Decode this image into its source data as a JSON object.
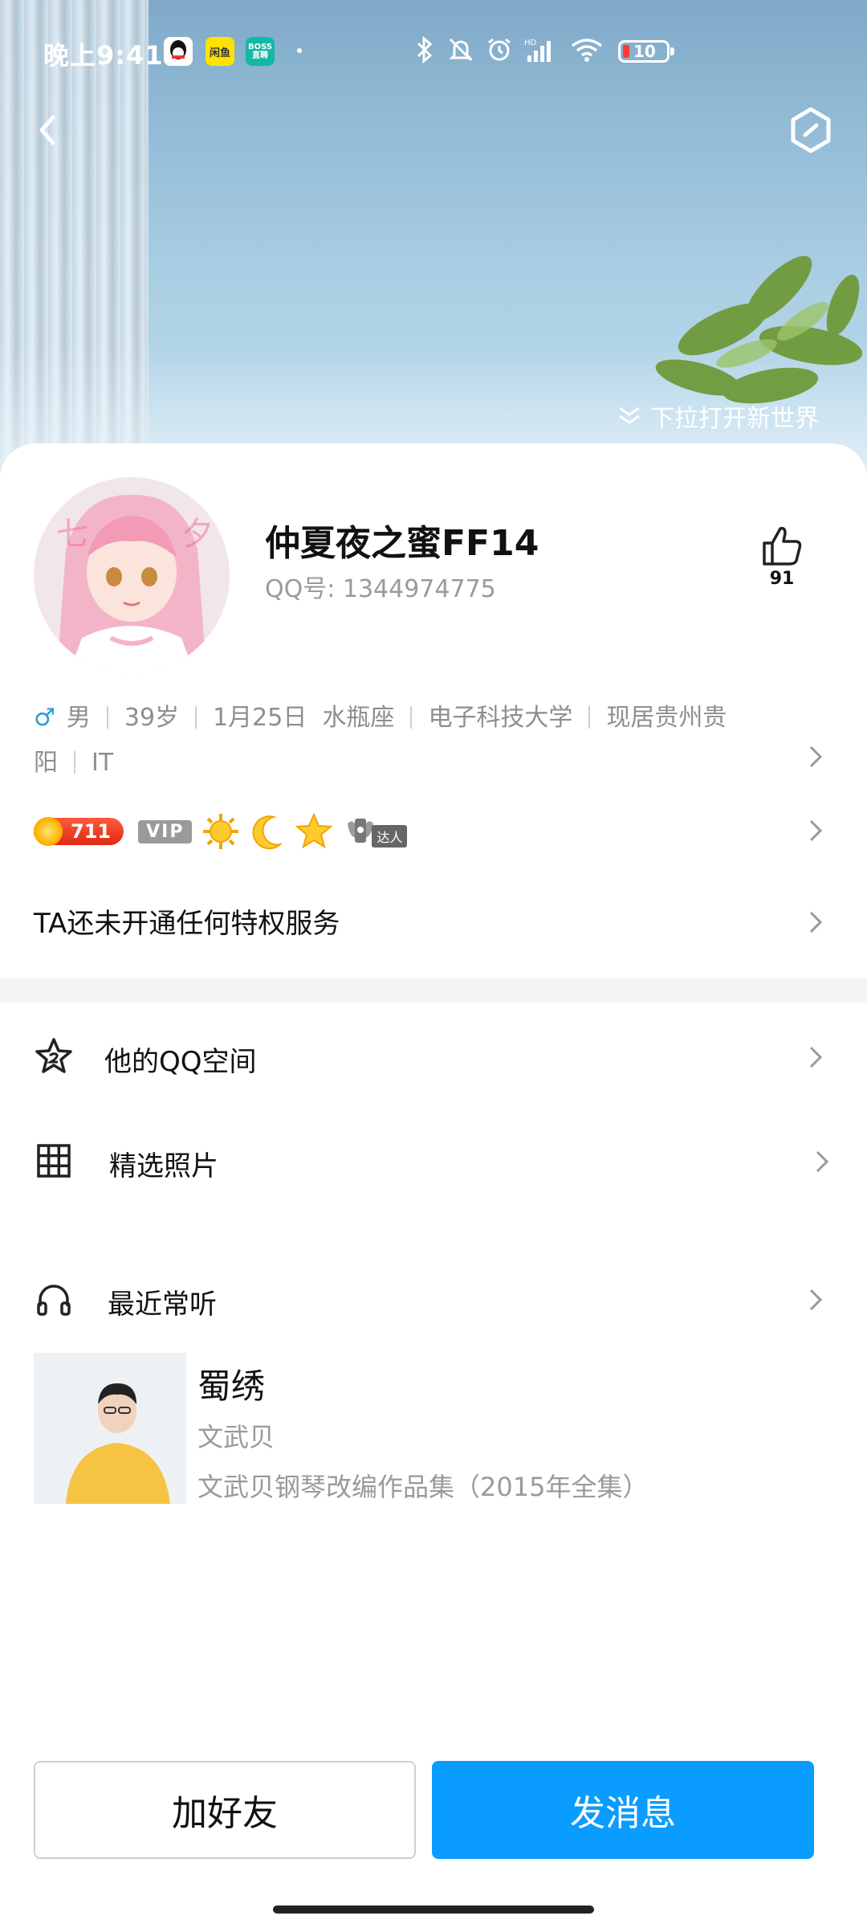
{
  "status_bar": {
    "time": "晚上9:41",
    "apps": [
      "qq",
      "闲鱼",
      "BOSS直聘"
    ],
    "battery": "10"
  },
  "header": {
    "pull_hint": "下拉打开新世界"
  },
  "profile": {
    "nickname": "仲夏夜之蜜FF14",
    "qq_number": "QQ号: 1344974775",
    "like_count": "91",
    "gender_symbol": "♂",
    "gender": "男",
    "age": "39岁",
    "birthday": "1月25日",
    "zodiac": "水瓶座",
    "school": "电子科技大学",
    "location_a": "现居贵州贵",
    "location_b": "阳",
    "industry": "IT",
    "level": "711",
    "vip": "VIP",
    "daren_tag": "达人",
    "privilege_text": "TA还未开通任何特权服务"
  },
  "menu": {
    "qzone": "他的QQ空间",
    "photos": "精选照片",
    "recent": "最近常听"
  },
  "music": {
    "song": "蜀绣",
    "artist": "文武贝",
    "album": "文武贝钢琴改编作品集（2015年全集）"
  },
  "actions": {
    "add_friend": "加好友",
    "send_message": "发消息"
  },
  "colors": {
    "accent": "#0a9cff",
    "male": "#2f9bd9"
  },
  "icons": [
    "back-icon",
    "hexagon-icon",
    "thumbs-up-icon",
    "star-icon",
    "grid-icon",
    "headphones-icon",
    "chevron-right-icon"
  ]
}
